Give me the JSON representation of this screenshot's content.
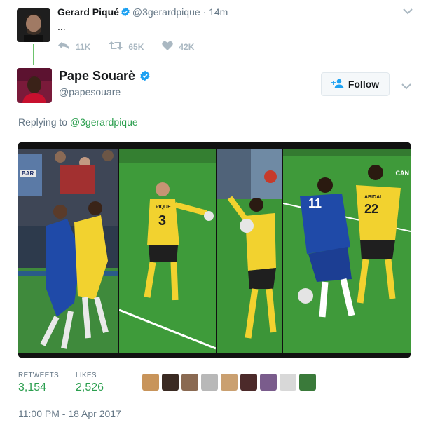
{
  "parent_tweet": {
    "name": "Gerard Piqué",
    "handle": "@3gerardpique",
    "separator": "·",
    "time": "14m",
    "body": "...",
    "replies": "11K",
    "retweets": "65K",
    "likes": "42K"
  },
  "tweet": {
    "name": "Pape Souarè",
    "handle": "@papesouare",
    "follow_label": "Follow",
    "replying_prefix": "Replying to",
    "replying_handle": "@3gerardpique",
    "media_texts": {
      "bar_badge": "BAR",
      "shirt_1": "PIQUE",
      "shirt_1_number": "3",
      "shirt_2_number": "11",
      "shirt_3": "ABIDAL",
      "shirt_3_number": "22",
      "corner_logo": "CAN"
    },
    "stats": {
      "retweets_label": "RETWEETS",
      "retweets_value": "3,154",
      "likes_label": "LIKES",
      "likes_value": "2,526"
    },
    "timestamp": "11:00 PM - 18 Apr 2017"
  },
  "colors": {
    "verified": "#1da1f2",
    "accent_green": "#2c9f4f",
    "muted": "#657786"
  }
}
